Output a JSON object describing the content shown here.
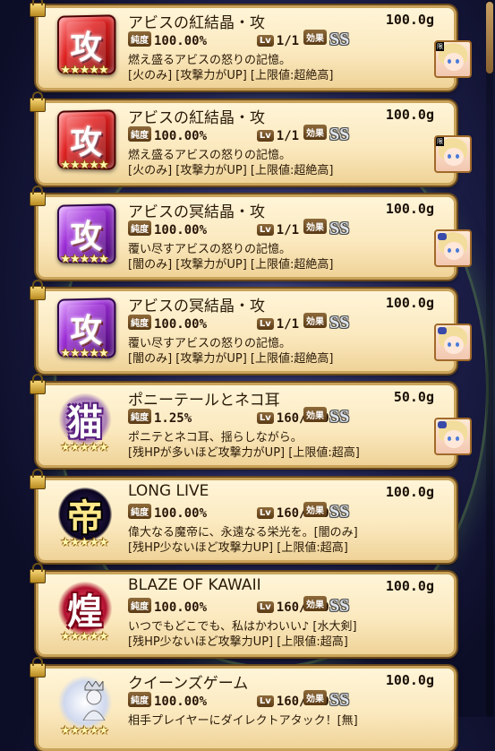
{
  "items": [
    {
      "name": "アビスの紅結晶・攻",
      "price": "100.0g",
      "purity_label": "純度",
      "purity": "100.00%",
      "lv_label": "Lv",
      "level": "1/1",
      "effect_label": "効果",
      "rank": "SS",
      "desc1": "燃え盛るアビスの怒りの記憶。",
      "desc2": "[火のみ] [攻撃力がUP] [上限値:超絶高]",
      "icon": "red-attack-crystal-icon",
      "icon_glyph": "攻",
      "stars": "★★★★★",
      "avatar_badge": "限"
    },
    {
      "name": "アビスの紅結晶・攻",
      "price": "100.0g",
      "purity_label": "純度",
      "purity": "100.00%",
      "lv_label": "Lv",
      "level": "1/1",
      "effect_label": "効果",
      "rank": "SS",
      "desc1": "燃え盛るアビスの怒りの記憶。",
      "desc2": "[火のみ] [攻撃力がUP] [上限値:超絶高]",
      "icon": "red-attack-crystal-icon",
      "icon_glyph": "攻",
      "stars": "★★★★★",
      "avatar_badge": "限"
    },
    {
      "name": "アビスの冥結晶・攻",
      "price": "100.0g",
      "purity_label": "純度",
      "purity": "100.00%",
      "lv_label": "Lv",
      "level": "1/1",
      "effect_label": "効果",
      "rank": "SS",
      "desc1": "覆い尽すアビスの怒りの記憶。",
      "desc2": "[闇のみ] [攻撃力がUP] [上限値:超絶高]",
      "icon": "purple-attack-crystal-icon",
      "icon_glyph": "攻",
      "stars": "★★★★★",
      "avatar_badge": ""
    },
    {
      "name": "アビスの冥結晶・攻",
      "price": "100.0g",
      "purity_label": "純度",
      "purity": "100.00%",
      "lv_label": "Lv",
      "level": "1/1",
      "effect_label": "効果",
      "rank": "SS",
      "desc1": "覆い尽すアビスの怒りの記憶。",
      "desc2": "[闇のみ] [攻撃力がUP] [上限値:超絶高]",
      "icon": "purple-attack-crystal-icon",
      "icon_glyph": "攻",
      "stars": "★★★★★",
      "avatar_badge": ""
    },
    {
      "name": "ポニーテールとネコ耳",
      "price": "50.0g",
      "purity_label": "純度",
      "purity": "1.25%",
      "lv_label": "Lv",
      "level": "160/160",
      "effect_label": "効果",
      "rank": "SS",
      "desc1": "ポニテとネコ耳、揺らしながら。",
      "desc2": "[残HPが多いほど攻撃力がUP] [上限値:超高]",
      "icon": "cat-emblem-icon",
      "icon_glyph": "猫",
      "stars": "★★★★★",
      "avatar_badge": ""
    },
    {
      "name": "LONG LIVE",
      "price": "100.0g",
      "purity_label": "純度",
      "purity": "100.00%",
      "lv_label": "Lv",
      "level": "160/160",
      "effect_label": "効果",
      "rank": "SS",
      "desc1": "偉大なる魔帝に、永遠なる栄光を。[闇のみ]",
      "desc2": "[残HP少ないほど攻撃力UP] [上限値:超高]",
      "icon": "emperor-emblem-icon",
      "icon_glyph": "帝",
      "stars": "★★★★★",
      "avatar_badge": ""
    },
    {
      "name": "BLAZE OF KAWAII",
      "price": "100.0g",
      "purity_label": "純度",
      "purity": "100.00%",
      "lv_label": "Lv",
      "level": "160/160",
      "effect_label": "効果",
      "rank": "SS",
      "desc1": "いつでもどこでも、私はかわいい♪ [水大剣]",
      "desc2": "[残HP少ないほど攻撃力UP] [上限値:超高]",
      "icon": "blaze-emblem-icon",
      "icon_glyph": "煌",
      "stars": "★★★★★",
      "avatar_badge": ""
    },
    {
      "name": "クイーンズゲーム",
      "price": "100.0g",
      "purity_label": "純度",
      "purity": "100.00%",
      "lv_label": "Lv",
      "level": "160/160",
      "effect_label": "効果",
      "rank": "SS",
      "desc1": "相手プレイヤーにダイレクトアタック！[無]",
      "desc2": "",
      "icon": "queen-emblem-icon",
      "icon_glyph": "",
      "stars": "★★★★★",
      "avatar_badge": ""
    }
  ]
}
